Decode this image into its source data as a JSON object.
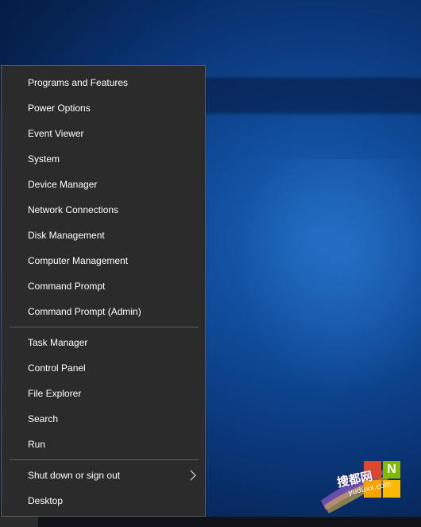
{
  "menu": {
    "group1": [
      {
        "label": "Programs and Features"
      },
      {
        "label": "Power Options"
      },
      {
        "label": "Event Viewer"
      },
      {
        "label": "System"
      },
      {
        "label": "Device Manager"
      },
      {
        "label": "Network Connections"
      },
      {
        "label": "Disk Management"
      },
      {
        "label": "Computer Management"
      },
      {
        "label": "Command Prompt"
      },
      {
        "label": "Command Prompt (Admin)"
      }
    ],
    "group2": [
      {
        "label": "Task Manager"
      },
      {
        "label": "Control Panel"
      },
      {
        "label": "File Explorer"
      },
      {
        "label": "Search"
      },
      {
        "label": "Run"
      }
    ],
    "group3": [
      {
        "label": "Shut down or sign out",
        "icon": "chevron-right-icon"
      },
      {
        "label": "Desktop"
      }
    ]
  },
  "watermark": {
    "title": "搜都网",
    "site": "yuduxx.com",
    "tile_letter": "N",
    "colors": [
      "#e0462a",
      "#7fba00",
      "#f7a400",
      "#ffb900"
    ]
  },
  "colors": {
    "menu_bg": "#2b2b2b",
    "menu_border": "#5a5a5a",
    "menu_text": "#ffffff",
    "separator": "#5c5c5c",
    "desktop_blue": "#0f4a98"
  }
}
